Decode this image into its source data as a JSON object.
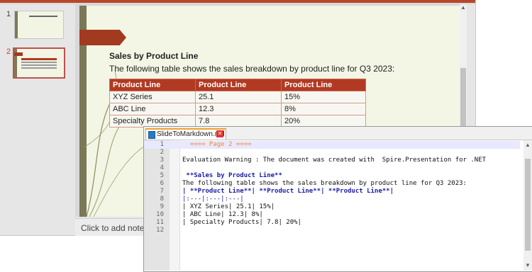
{
  "thumbnails": [
    {
      "number": "1"
    },
    {
      "number": "2"
    }
  ],
  "slide": {
    "title": "Sales by Product Line",
    "subtitle": "The following table shows the sales breakdown by product line for Q3 2023:",
    "table": {
      "headers": [
        "Product Line",
        "Product Line",
        "Product Line"
      ],
      "rows": [
        [
          "XYZ Series",
          "25.1",
          "15%"
        ],
        [
          "ABC Line",
          "12.3",
          "8%"
        ],
        [
          "Specialty Products",
          "7.8",
          "20%"
        ]
      ]
    }
  },
  "notes": {
    "placeholder": "Click to add notes"
  },
  "editor": {
    "tab_filename": "SlideToMarkdown.md",
    "lines": [
      {
        "n": "1",
        "text": "  ==== Page 2 ===="
      },
      {
        "n": "2",
        "text": ""
      },
      {
        "n": "3",
        "text": "Evaluation Warning : The document was created with  Spire.Presentation for .NET"
      },
      {
        "n": "4",
        "text": ""
      },
      {
        "n": "5",
        "text": " **Sales by Product Line**"
      },
      {
        "n": "6",
        "text": "The following table shows the sales breakdown by product line for Q3 2023:"
      },
      {
        "n": "7",
        "text": "| **Product Line**| **Product Line**| **Product Line**|"
      },
      {
        "n": "8",
        "text": "|:---|:---|:---|"
      },
      {
        "n": "9",
        "text": "| XYZ Series| 25.1| 15%|"
      },
      {
        "n": "10",
        "text": "| ABC Line| 12.3| 8%|"
      },
      {
        "n": "11",
        "text": "| Specialty Products| 7.8| 20%|"
      },
      {
        "n": "12",
        "text": ""
      }
    ]
  },
  "colors": {
    "accent": "#b23a22",
    "tab_accent": "#f0a030"
  }
}
